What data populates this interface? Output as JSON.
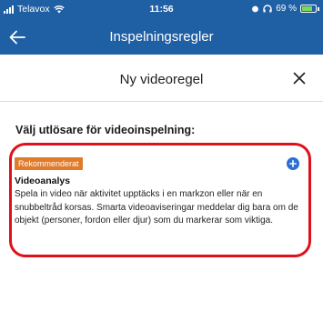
{
  "status_bar": {
    "carrier": "Telavox",
    "time": "11:56",
    "battery": "69 %"
  },
  "app_bar": {
    "title": "Inspelningsregler",
    "back_icon": "arrow-left-icon"
  },
  "sheet": {
    "title": "Ny videoregel",
    "close_icon": "close-icon"
  },
  "section": {
    "heading": "Välj utlösare för videoinspelning:"
  },
  "option": {
    "badge": "Rekommenderat",
    "title": "Videoanalys",
    "description": "Spela in video när aktivitet upptäcks i en markzon eller när en snubbeltråd korsas. Smarta videoaviseringar meddelar dig bara om de objekt (personer, fordon eller djur) som du markerar som viktiga.",
    "add_icon": "plus-circle-icon"
  },
  "colors": {
    "header_bg": "#1f5fa3",
    "badge_bg": "#e07b2a",
    "highlight_border": "#e0101b",
    "add_button": "#2c6fd1"
  }
}
